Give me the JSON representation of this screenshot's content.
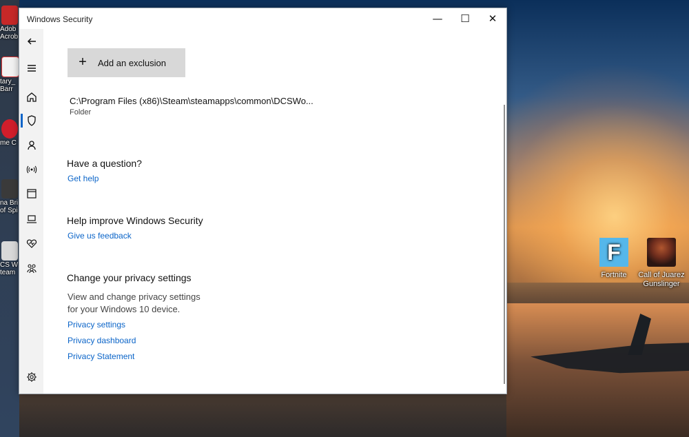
{
  "window": {
    "title": "Windows Security"
  },
  "buttons": {
    "add_exclusion": "Add an exclusion"
  },
  "exclusion": {
    "path": "C:\\Program Files (x86)\\Steam\\steamapps\\common\\DCSWo...",
    "type": "Folder"
  },
  "sections": {
    "question_heading": "Have a question?",
    "question_link": "Get help",
    "improve_heading": "Help improve Windows Security",
    "improve_link": "Give us feedback",
    "privacy_heading": "Change your privacy settings",
    "privacy_text_line1": "View and change privacy settings",
    "privacy_text_line2": "for your Windows 10 device.",
    "privacy_links": [
      "Privacy settings",
      "Privacy dashboard",
      "Privacy Statement"
    ]
  },
  "desktop": {
    "left_icons": [
      "Adob Acrob",
      "tary_ Barr",
      "me C",
      "na Bri of Spi",
      "CS W team"
    ],
    "right_icons": [
      "Fortnite",
      "Call of Juarez Gunslinger"
    ]
  },
  "colors": {
    "accent": "#0a64c8",
    "button_gray": "#d8d8d8",
    "sidebar_bg": "#f2f2f2"
  }
}
